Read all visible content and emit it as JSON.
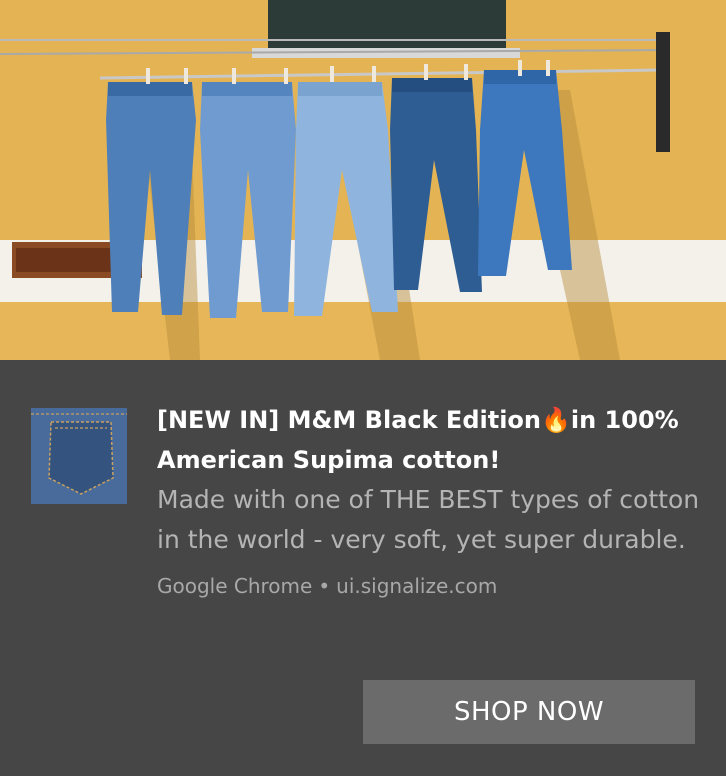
{
  "notification": {
    "hero_image_alt": "jeans-on-clothesline",
    "thumbnail_icon": "denim-pocket-image",
    "title": "[NEW IN] M&M Black Edition🔥in 100% American Supima cotton!",
    "message": "Made with one of THE BEST types of cotton in the world - very soft, yet super durable.",
    "source_app": "Google Chrome",
    "separator": "•",
    "source_domain": "ui.signalize.com",
    "action_label": "SHOP NOW"
  },
  "colors": {
    "background": "#464646",
    "title": "#ffffff",
    "message": "#b4b4b4",
    "attribution": "#a8a8a8",
    "button_bg": "#6b6b6b",
    "button_text": "#ffffff"
  }
}
